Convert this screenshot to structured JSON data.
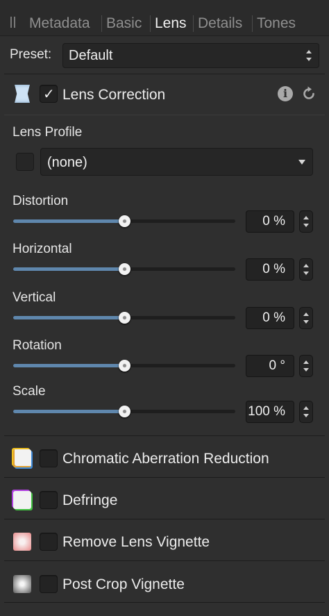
{
  "tabs": [
    {
      "label": "Metadata",
      "active": false
    },
    {
      "label": "Basic",
      "active": false
    },
    {
      "label": "Lens",
      "active": true
    },
    {
      "label": "Details",
      "active": false
    },
    {
      "label": "Tones",
      "active": false
    }
  ],
  "preset": {
    "label": "Preset:",
    "value": "Default"
  },
  "lens_correction": {
    "title": "Lens Correction",
    "enabled": true,
    "check_mark": "✓",
    "lens_profile": {
      "label": "Lens Profile",
      "value": "(none)"
    },
    "sliders": [
      {
        "label": "Distortion",
        "value_text": "0 %",
        "position": 0.5
      },
      {
        "label": "Horizontal",
        "value_text": "0 %",
        "position": 0.5
      },
      {
        "label": "Vertical",
        "value_text": "0 %",
        "position": 0.5
      },
      {
        "label": "Rotation",
        "value_text": "0 °",
        "position": 0.5
      },
      {
        "label": "Scale",
        "value_text": "100 %",
        "position": 0.5
      }
    ]
  },
  "sections": [
    {
      "title": "Chromatic Aberration Reduction",
      "enabled": false
    },
    {
      "title": "Defringe",
      "enabled": false
    },
    {
      "title": "Remove Lens Vignette",
      "enabled": false
    },
    {
      "title": "Post Crop Vignette",
      "enabled": false
    }
  ],
  "icons": {
    "info": "i",
    "lens_correction": "lens-distortion-icon",
    "chromatic_aberration": "chromatic-aberration-icon",
    "defringe": "defringe-icon",
    "remove_vignette": "lens-vignette-icon",
    "post_crop_vignette": "post-crop-vignette-icon"
  },
  "colors": {
    "accent": "#5f87ad",
    "panel": "#2f2f2f",
    "field": "#262626"
  }
}
